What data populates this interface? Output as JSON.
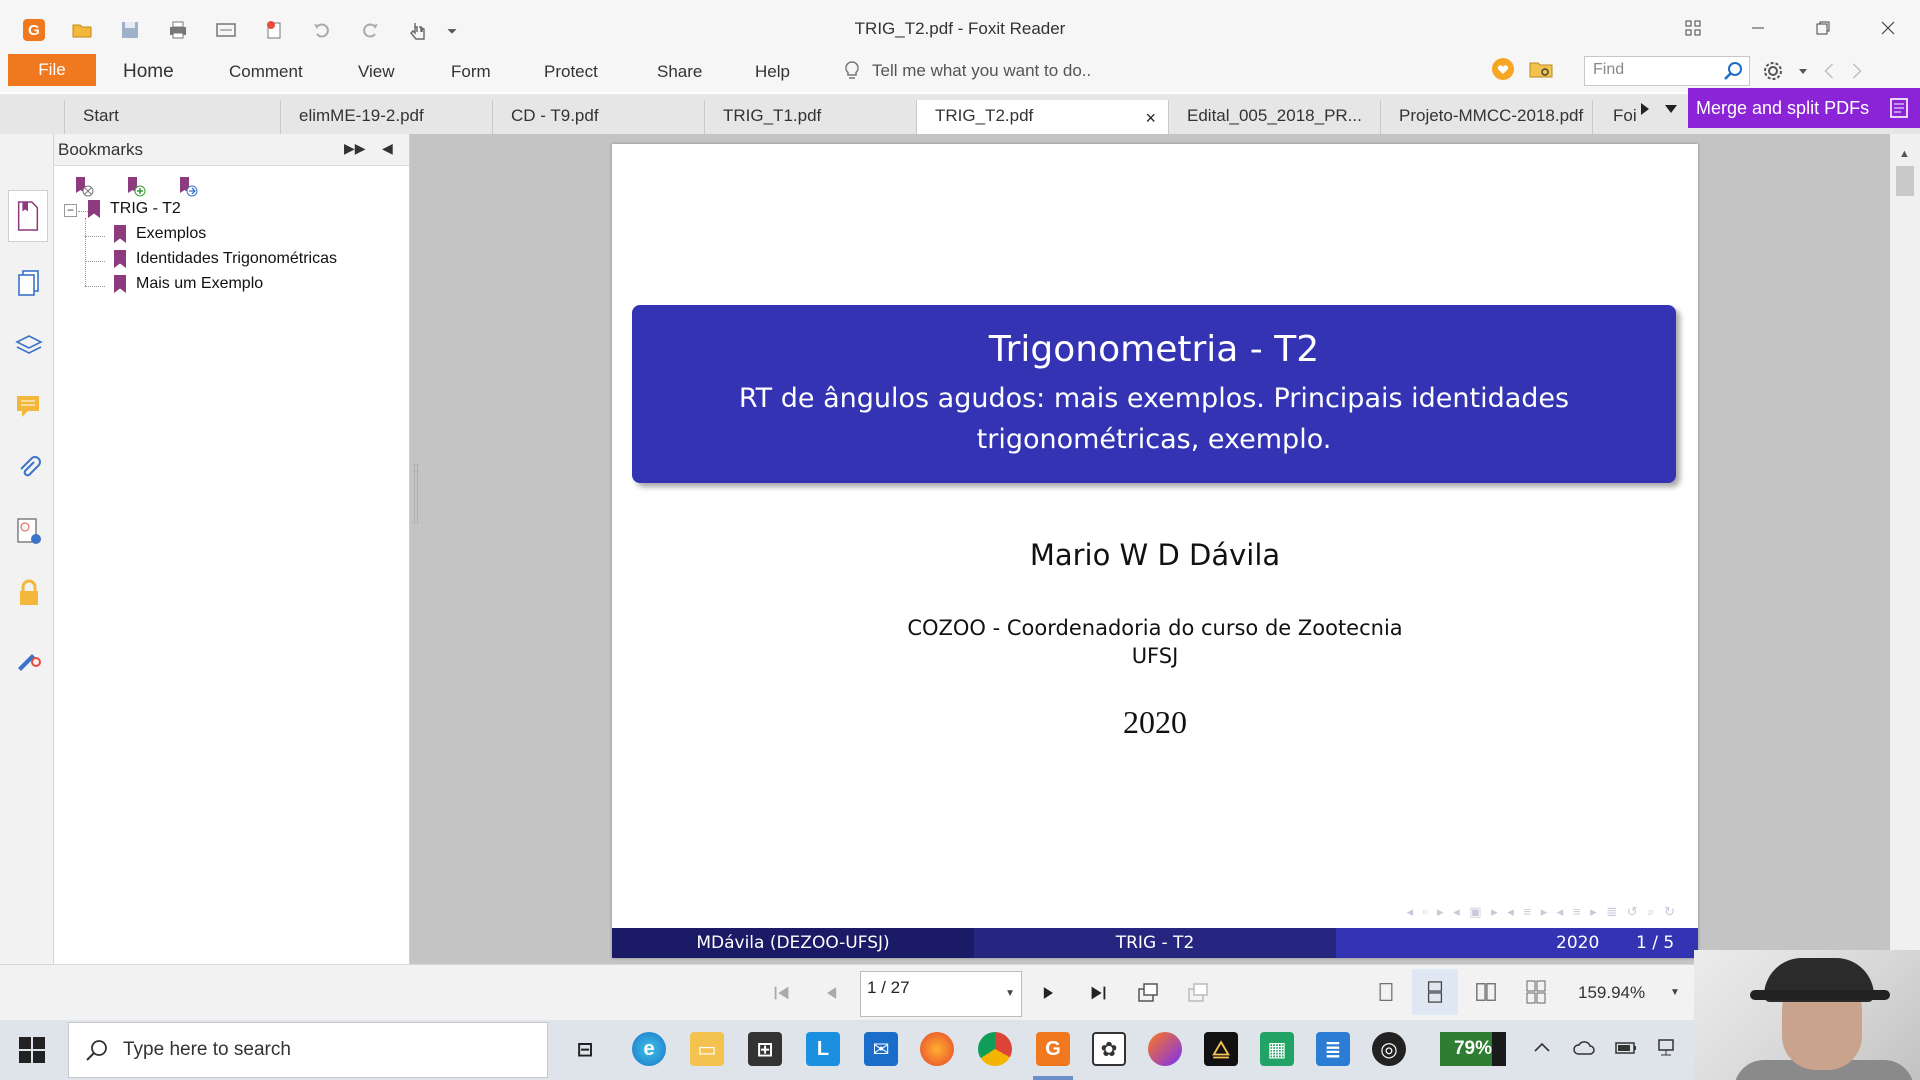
{
  "window": {
    "title": "TRIG_T2.pdf - Foxit Reader"
  },
  "menu": {
    "file": "File",
    "items": [
      "Home",
      "Comment",
      "View",
      "Form",
      "Protect",
      "Share",
      "Help"
    ],
    "tell_me": "Tell me what you want to do..",
    "find_placeholder": "Find"
  },
  "tabs": [
    {
      "label": "Start"
    },
    {
      "label": "elimME-19-2.pdf"
    },
    {
      "label": "CD - T9.pdf"
    },
    {
      "label": "TRIG_T1.pdf"
    },
    {
      "label": "TRIG_T2.pdf",
      "active": true,
      "close": "×"
    },
    {
      "label": "Edital_005_2018_PR..."
    },
    {
      "label": "Projeto-MMCC-2018.pdf"
    },
    {
      "label": "Foi"
    }
  ],
  "merge_button": {
    "label": "Merge and split PDFs"
  },
  "bookmarks": {
    "header": "Bookmarks",
    "root": "TRIG - T2",
    "expander": "−",
    "children": [
      "Exemplos",
      "Identidades Trigonométricas",
      "Mais um Exemplo"
    ]
  },
  "slide": {
    "title": "Trigonometria - T2",
    "subtitle": "RT de ângulos agudos: mais exemplos. Principais identidades trigonométricas, exemplo.",
    "author": "Mario W D Dávila",
    "institution_line1": "COZOO - Coordenadoria do curso de Zootecnia",
    "institution_line2": "UFSJ",
    "year": "2020",
    "footer": {
      "left": "MDávila  (DEZOO-UFSJ)",
      "center": "TRIG - T2",
      "year": "2020",
      "page": "1 / 5"
    }
  },
  "status": {
    "page_input": "1 / 27",
    "zoom": "159.94%"
  },
  "taskbar": {
    "search_placeholder": "Type here to search",
    "battery_percent": "79%",
    "battery_level": 0.79
  },
  "colors": {
    "accent_orange": "#f0781e",
    "merge_purple": "#8b24d6",
    "beamer_blue": "#3333b3",
    "footer_dark": "#1a1a66"
  }
}
